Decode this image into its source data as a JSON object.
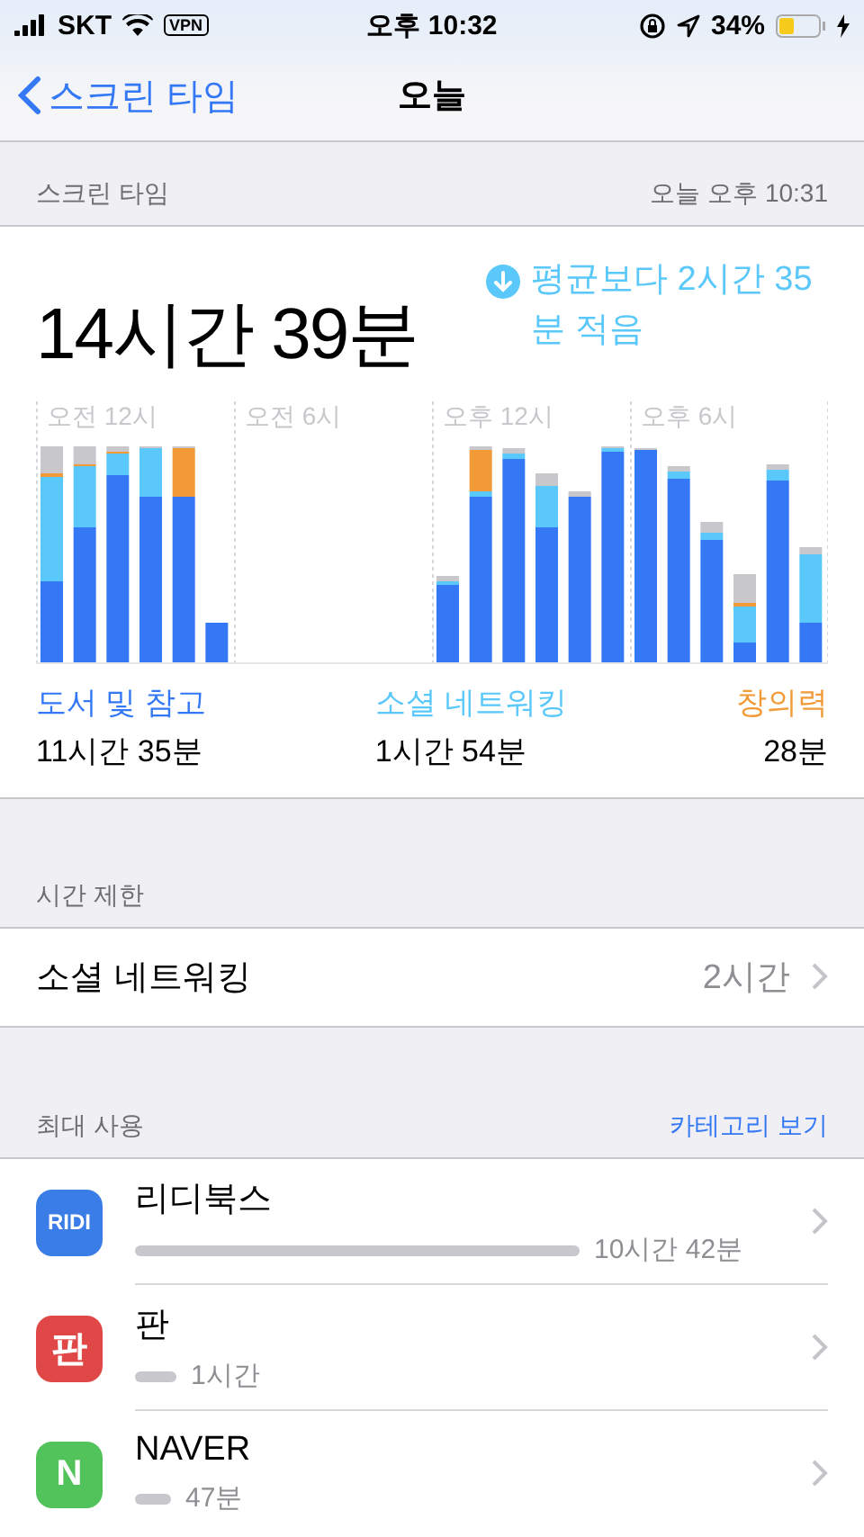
{
  "status_bar": {
    "carrier": "SKT",
    "vpn": "VPN",
    "time": "오후 10:32",
    "battery": "34%"
  },
  "nav": {
    "back": "스크린 타임",
    "title": "오늘"
  },
  "header": {
    "left": "스크린 타임",
    "right": "오늘 오후 10:31"
  },
  "summary": {
    "total": "14시간 39분",
    "average_note": "평균보다 2시간 35분 적음"
  },
  "chart": {
    "axis_labels": [
      "오전 12시",
      "오전 6시",
      "오후 12시",
      "오후 6시"
    ]
  },
  "legend": [
    {
      "name": "도서 및 참고",
      "time": "11시간 35분",
      "color": "#3478f6"
    },
    {
      "name": "소셜 네트워킹",
      "time": "1시간 54분",
      "color": "#5ac8fa"
    },
    {
      "name": "창의력",
      "time": "28분",
      "color": "#f19a37"
    }
  ],
  "limits": {
    "header": "시간 제한",
    "rows": [
      {
        "label": "소셜 네트워킹",
        "value": "2시간"
      }
    ]
  },
  "most_used": {
    "header": "최대 사용",
    "link": "카테고리 보기",
    "apps": [
      {
        "name": "리디북스",
        "time": "10시간 42분",
        "icon_text": "RIDI",
        "color": "#3a7de6"
      },
      {
        "name": "판",
        "time": "1시간",
        "icon_text": "판",
        "color": "#e04848"
      },
      {
        "name": "NAVER",
        "time": "47분",
        "icon_text": "N",
        "color": "#52c35a"
      }
    ]
  }
}
